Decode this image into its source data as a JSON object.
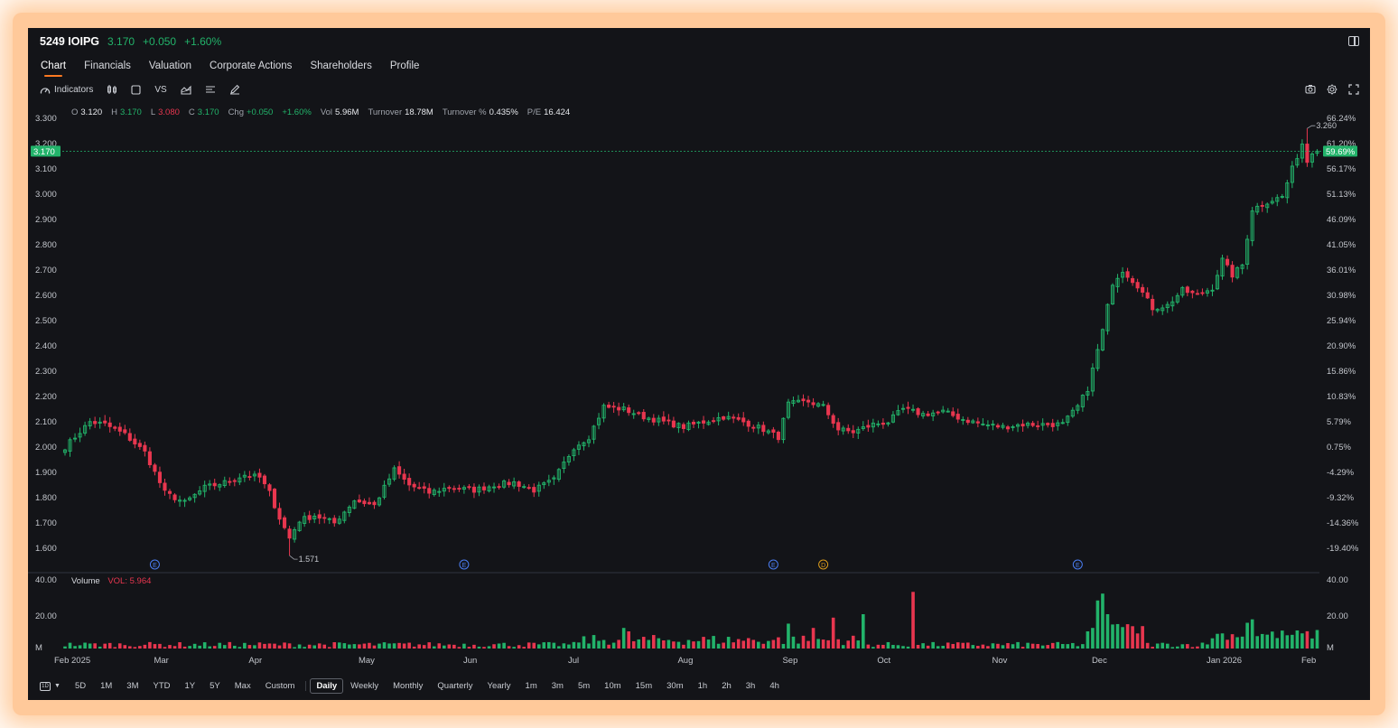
{
  "quote": {
    "symbol": "5249 IOIPG",
    "price": "3.170",
    "change": "+0.050",
    "change_pct": "+1.60%"
  },
  "tabs": [
    "Chart",
    "Financials",
    "Valuation",
    "Corporate Actions",
    "Shareholders",
    "Profile"
  ],
  "toolbar": {
    "indicators": "Indicators",
    "vs": "VS"
  },
  "ohlc": {
    "open_k": "O",
    "open": "3.120",
    "high_k": "H",
    "high": "3.170",
    "low_k": "L",
    "low": "3.080",
    "close_k": "C",
    "close": "3.170",
    "chg_k": "Chg",
    "chg": "+0.050",
    "chg_pct": "+1.60%",
    "vol_k": "Vol",
    "vol": "5.96M",
    "turnover_k": "Turnover",
    "turnover": "18.78M",
    "turnover_pct_k": "Turnover %",
    "turnover_pct": "0.435%",
    "pe_k": "P/E",
    "pe": "16.424"
  },
  "volume_title": {
    "label": "Volume",
    "value": "VOL: 5.964"
  },
  "bottombar": {
    "range_icon": "1D",
    "ranges": [
      "5D",
      "1M",
      "3M",
      "YTD",
      "1Y",
      "5Y",
      "Max",
      "Custom"
    ],
    "periods": [
      "Daily",
      "Weekly",
      "Monthly",
      "Quarterly",
      "Yearly"
    ],
    "intervals": [
      "1m",
      "3m",
      "5m",
      "10m",
      "15m",
      "30m",
      "1h",
      "2h",
      "3h",
      "4h"
    ],
    "active_period": "Daily"
  },
  "colors": {
    "up": "#22b36a",
    "down": "#e8364f",
    "accent": "#ff7a22",
    "event": "#4a7cf0",
    "dividend": "#d99a1c"
  },
  "chart_data": {
    "type": "candlestick",
    "y_ticks": [
      "3.300",
      "3.200",
      "3.100",
      "3.000",
      "2.900",
      "2.800",
      "2.700",
      "2.600",
      "2.500",
      "2.400",
      "2.300",
      "2.200",
      "2.100",
      "2.000",
      "1.900",
      "1.800",
      "1.700",
      "1.600"
    ],
    "pct_ticks": [
      "66.24%",
      "61.20%",
      "56.17%",
      "51.13%",
      "46.09%",
      "41.05%",
      "36.01%",
      "30.98%",
      "25.94%",
      "20.90%",
      "15.86%",
      "10.83%",
      "5.79%",
      "0.75%",
      "-4.29%",
      "-9.32%",
      "-14.36%",
      "-19.40%"
    ],
    "ylim": [
      1.55,
      3.32
    ],
    "x_labels": [
      "Feb 2025",
      "Mar",
      "Apr",
      "May",
      "Jun",
      "Jul",
      "Aug",
      "Sep",
      "Oct",
      "Nov",
      "Dec",
      "Jan 2026",
      "Feb"
    ],
    "x_label_index": [
      0,
      20,
      39,
      61,
      82,
      103,
      125,
      146,
      165,
      188,
      208,
      231,
      250
    ],
    "last_price": "3.170",
    "last_pct": "59.69%",
    "high_marker": {
      "value": 3.26,
      "label": "3.260",
      "index": 249
    },
    "low_marker": {
      "value": 1.571,
      "label": "1.571",
      "index": 45
    },
    "events": [
      {
        "label": "E",
        "index": 18,
        "kind": "earnings"
      },
      {
        "label": "E",
        "index": 80,
        "kind": "earnings"
      },
      {
        "label": "E",
        "index": 142,
        "kind": "earnings"
      },
      {
        "label": "D",
        "index": 152,
        "kind": "dividend"
      },
      {
        "label": "E",
        "index": 203,
        "kind": "earnings"
      }
    ],
    "close_anchors": [
      [
        0,
        2.0
      ],
      [
        5,
        2.1
      ],
      [
        8,
        2.09
      ],
      [
        12,
        2.05
      ],
      [
        16,
        1.98
      ],
      [
        20,
        1.82
      ],
      [
        24,
        1.78
      ],
      [
        28,
        1.84
      ],
      [
        32,
        1.86
      ],
      [
        36,
        1.89
      ],
      [
        39,
        1.88
      ],
      [
        41,
        1.82
      ],
      [
        43,
        1.72
      ],
      [
        45,
        1.64
      ],
      [
        47,
        1.71
      ],
      [
        50,
        1.73
      ],
      [
        54,
        1.7
      ],
      [
        58,
        1.79
      ],
      [
        62,
        1.77
      ],
      [
        66,
        1.91
      ],
      [
        69,
        1.85
      ],
      [
        73,
        1.82
      ],
      [
        77,
        1.84
      ],
      [
        82,
        1.83
      ],
      [
        86,
        1.85
      ],
      [
        90,
        1.86
      ],
      [
        94,
        1.83
      ],
      [
        98,
        1.87
      ],
      [
        102,
        2.0
      ],
      [
        105,
        2.04
      ],
      [
        108,
        2.16
      ],
      [
        112,
        2.15
      ],
      [
        116,
        2.12
      ],
      [
        120,
        2.1
      ],
      [
        124,
        2.08
      ],
      [
        128,
        2.1
      ],
      [
        132,
        2.12
      ],
      [
        136,
        2.1
      ],
      [
        140,
        2.07
      ],
      [
        143,
        2.04
      ],
      [
        145,
        2.17
      ],
      [
        149,
        2.18
      ],
      [
        152,
        2.16
      ],
      [
        155,
        2.07
      ],
      [
        158,
        2.06
      ],
      [
        162,
        2.09
      ],
      [
        165,
        2.1
      ],
      [
        168,
        2.15
      ],
      [
        172,
        2.13
      ],
      [
        176,
        2.14
      ],
      [
        180,
        2.11
      ],
      [
        184,
        2.09
      ],
      [
        188,
        2.08
      ],
      [
        192,
        2.09
      ],
      [
        196,
        2.09
      ],
      [
        200,
        2.09
      ],
      [
        203,
        2.16
      ],
      [
        205,
        2.23
      ],
      [
        208,
        2.46
      ],
      [
        210,
        2.65
      ],
      [
        212,
        2.7
      ],
      [
        215,
        2.64
      ],
      [
        218,
        2.55
      ],
      [
        221,
        2.56
      ],
      [
        224,
        2.62
      ],
      [
        227,
        2.6
      ],
      [
        230,
        2.63
      ],
      [
        232,
        2.74
      ],
      [
        234,
        2.68
      ],
      [
        236,
        2.72
      ],
      [
        238,
        2.94
      ],
      [
        241,
        2.97
      ],
      [
        244,
        2.99
      ],
      [
        246,
        3.1
      ],
      [
        248,
        3.2
      ],
      [
        249,
        3.13
      ],
      [
        250,
        3.17
      ]
    ],
    "volume": {
      "y_ticks": [
        "40.00",
        "20.00",
        "M"
      ],
      "ylim": [
        0,
        40
      ],
      "spikes": [
        [
          145,
          14.5
        ],
        [
          150,
          12
        ],
        [
          154,
          18
        ],
        [
          170,
          33
        ],
        [
          206,
          12
        ],
        [
          207,
          28
        ],
        [
          208,
          32
        ],
        [
          209,
          20
        ],
        [
          210,
          14
        ],
        [
          214,
          13
        ],
        [
          237,
          15
        ],
        [
          238,
          17
        ]
      ]
    },
    "n_bars": 252
  }
}
